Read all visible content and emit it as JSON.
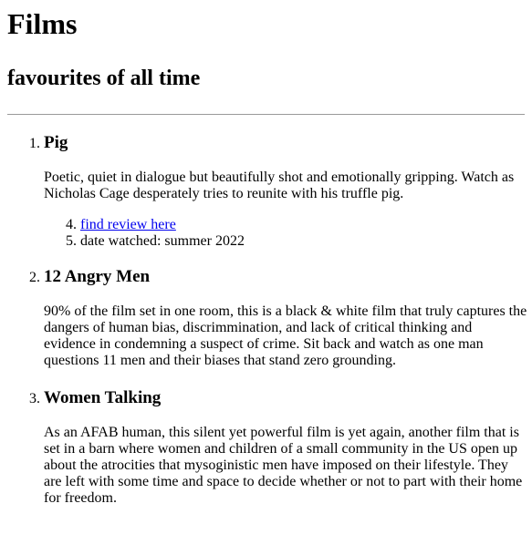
{
  "page": {
    "title": "Films",
    "subtitle": "favourites of all time"
  },
  "films": [
    {
      "title": "Pig",
      "description": "Poetic, quiet in dialogue but beautifully shot and emotionally gripping. Watch as Nicholas Cage desperately tries to reunite with his truffle pig.",
      "details": {
        "link_text": "find review here",
        "date_watched": "date watched: summer 2022"
      }
    },
    {
      "title": "12 Angry Men",
      "description": "90% of the film set in one room, this is a black & white film that truly captures the dangers of human bias, discrimmination, and lack of critical thinking and evidence in condemning a suspect of crime. Sit back and watch as one man questions 11 men and their biases that stand zero grounding."
    },
    {
      "title": "Women Talking",
      "description": "As an AFAB human, this silent yet powerful film is yet again, another film that is set in a barn where women and children of a small community in the US open up about the atrocities that mysoginistic men have imposed on their lifestyle. They are left with some time and space to decide whether or not to part with their home for freedom."
    }
  ],
  "colors": {
    "link": "#0000ee",
    "rule": "#9a9a9a"
  }
}
